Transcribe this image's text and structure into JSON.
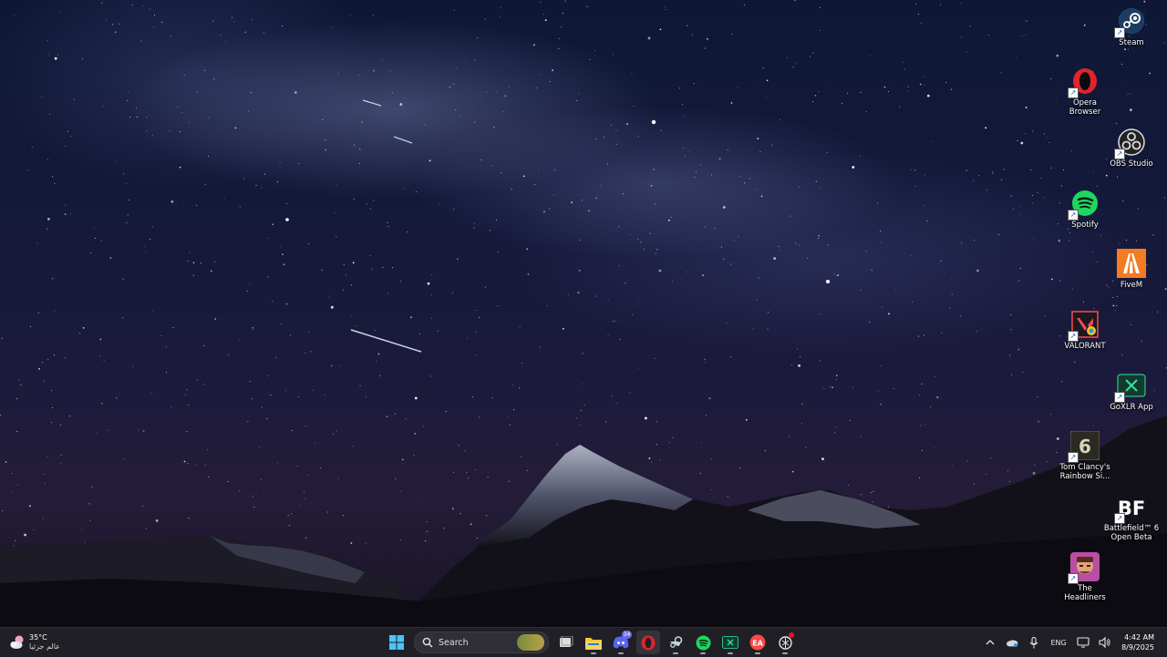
{
  "desktop": {
    "icons": [
      {
        "label": "Steam",
        "icon": "steam-icon"
      },
      {
        "label": "Opera\nBrowser",
        "icon": "opera-icon"
      },
      {
        "label": "OBS Studio",
        "icon": "obs-icon"
      },
      {
        "label": "Spotify",
        "icon": "spotify-icon"
      },
      {
        "label": "FiveM",
        "icon": "fivem-icon"
      },
      {
        "label": "VALORANT",
        "icon": "valorant-icon"
      },
      {
        "label": "GoXLR App",
        "icon": "goxlr-icon"
      },
      {
        "label": "Tom Clancy's\nRainbow Si...",
        "icon": "rainbow-six-icon"
      },
      {
        "label": "Battlefield™ 6\nOpen Beta",
        "icon": "battlefield-icon"
      },
      {
        "label": "The\nHeadliners",
        "icon": "headliners-icon"
      }
    ]
  },
  "taskbar": {
    "weather": {
      "temp": "35°C",
      "desc": "عالم جزئيا"
    },
    "search": {
      "placeholder": "Search"
    },
    "apps": [
      {
        "name": "start",
        "icon": "windows-start-icon"
      },
      {
        "name": "task-view",
        "icon": "task-view-icon"
      },
      {
        "name": "file-explorer",
        "icon": "folder-icon"
      },
      {
        "name": "discord",
        "icon": "discord-icon",
        "badge": "34"
      },
      {
        "name": "opera",
        "icon": "opera-icon"
      },
      {
        "name": "steam",
        "icon": "steam-icon"
      },
      {
        "name": "spotify",
        "icon": "spotify-icon"
      },
      {
        "name": "goxlr",
        "icon": "goxlr-icon"
      },
      {
        "name": "ea",
        "icon": "ea-icon"
      },
      {
        "name": "openai",
        "icon": "openai-icon"
      }
    ],
    "tray": {
      "language": "ENG",
      "time": "4:42 AM",
      "date": "8/9/2025"
    }
  },
  "colors": {
    "taskbar_bg": "#1f1f25",
    "accent": "#7fb4ff",
    "spotify": "#1ed760",
    "opera": "#e0242b",
    "discord": "#5865f2",
    "fivem": "#f27c24"
  }
}
